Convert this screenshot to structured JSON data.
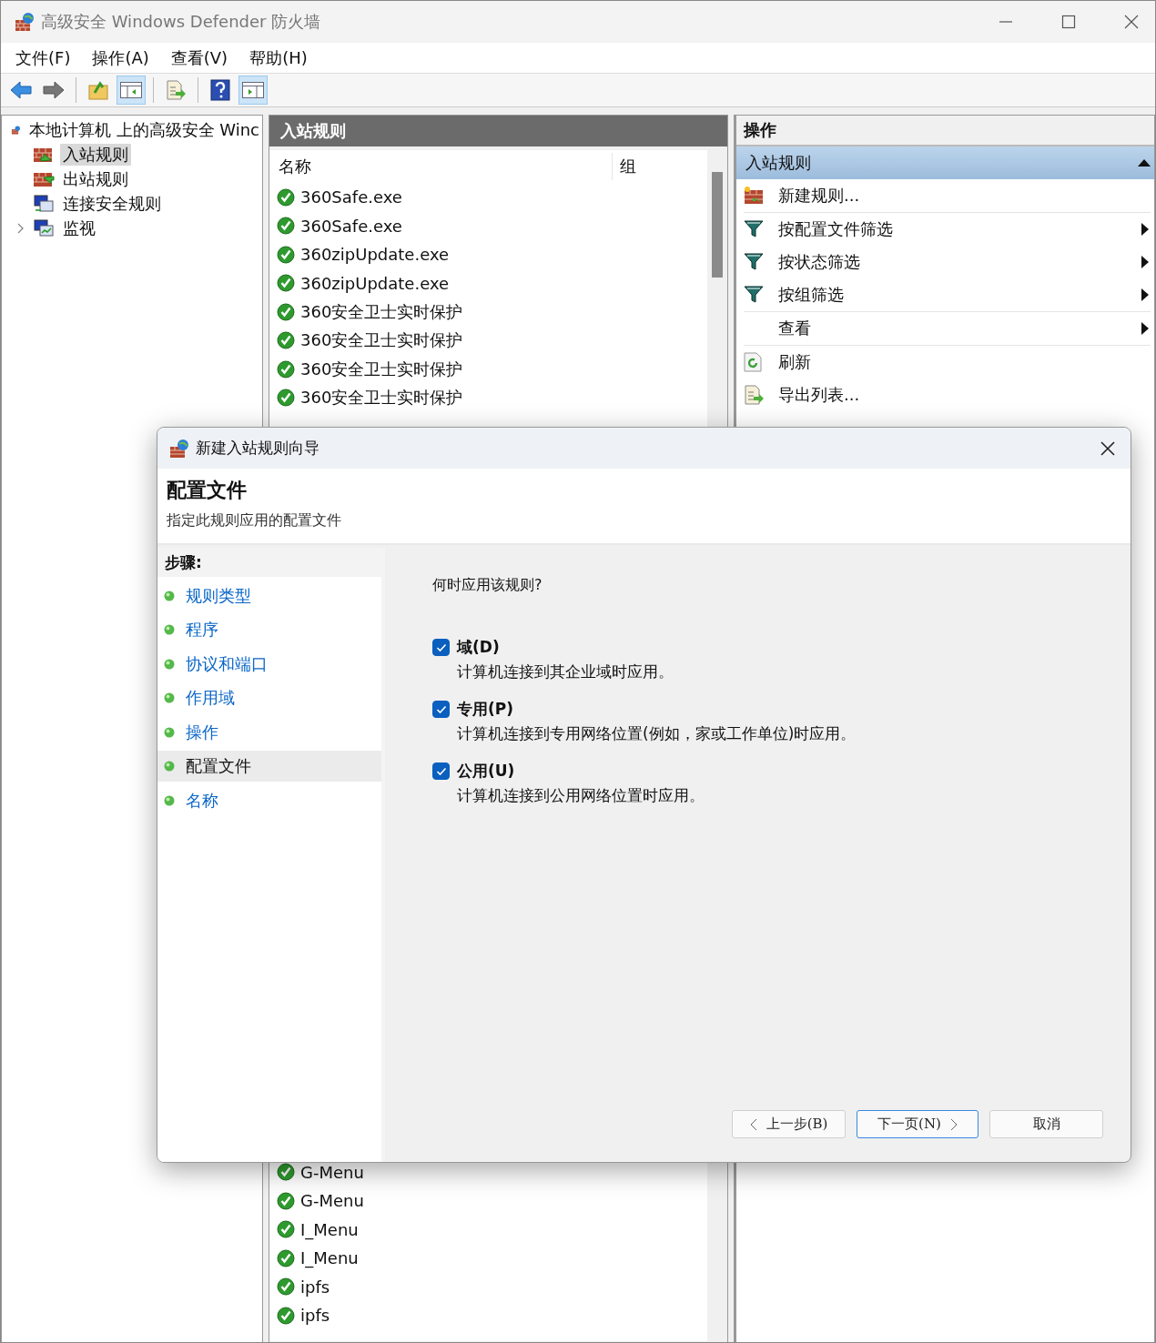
{
  "window": {
    "title": "高级安全 Windows Defender 防火墙"
  },
  "menu": [
    {
      "label": "文件(F)"
    },
    {
      "label": "操作(A)"
    },
    {
      "label": "查看(V)"
    },
    {
      "label": "帮助(H)"
    }
  ],
  "toolbar": [
    {
      "kind": "back",
      "pressed": false
    },
    {
      "kind": "forward",
      "pressed": false
    },
    {
      "kind": "up",
      "pressed": false
    },
    {
      "kind": "tree",
      "pressed": true
    },
    {
      "kind": "export",
      "pressed": false
    },
    {
      "kind": "help",
      "pressed": false
    },
    {
      "kind": "action-pane",
      "pressed": true
    }
  ],
  "tree": {
    "label": "本地计算机 上的高级安全 Winc",
    "children": [
      {
        "label": "入站规则",
        "kind": "inbound",
        "selected": true,
        "expandable": false
      },
      {
        "label": "出站规则",
        "kind": "outbound",
        "selected": false,
        "expandable": false
      },
      {
        "label": "连接安全规则",
        "kind": "connection",
        "selected": false,
        "expandable": false
      },
      {
        "label": "监视",
        "kind": "monitor",
        "selected": false,
        "expandable": true
      }
    ]
  },
  "rules_pane": {
    "title": "入站规则",
    "columns": [
      "名称",
      "组"
    ],
    "rows_top": [
      {
        "name": "360Safe.exe",
        "enabled": true
      },
      {
        "name": "360Safe.exe",
        "enabled": true
      },
      {
        "name": "360zipUpdate.exe",
        "enabled": true
      },
      {
        "name": "360zipUpdate.exe",
        "enabled": true
      },
      {
        "name": "360安全卫士实时保护",
        "enabled": true
      },
      {
        "name": "360安全卫士实时保护",
        "enabled": true
      },
      {
        "name": "360安全卫士实时保护",
        "enabled": true
      },
      {
        "name": "360安全卫士实时保护",
        "enabled": true
      }
    ],
    "rows_bottom": [
      {
        "name": "G-Menu",
        "enabled": true
      },
      {
        "name": "G-Menu",
        "enabled": true
      },
      {
        "name": "I_Menu",
        "enabled": true
      },
      {
        "name": "I_Menu",
        "enabled": true
      },
      {
        "name": "ipfs",
        "enabled": true
      },
      {
        "name": "ipfs",
        "enabled": true
      }
    ]
  },
  "actions_pane": {
    "title": "操作",
    "section": {
      "label": "入站规则",
      "expanded": true
    },
    "items": [
      {
        "label": "新建规则...",
        "kind": "new-rule",
        "submenu": false
      },
      {
        "label": "按配置文件筛选",
        "kind": "filter",
        "submenu": true
      },
      {
        "label": "按状态筛选",
        "kind": "filter",
        "submenu": true
      },
      {
        "label": "按组筛选",
        "kind": "filter",
        "submenu": true
      },
      {
        "label": "查看",
        "kind": "none",
        "submenu": true
      },
      {
        "label": "刷新",
        "kind": "refresh",
        "submenu": false
      },
      {
        "label": "导出列表...",
        "kind": "export",
        "submenu": false
      }
    ]
  },
  "dialog": {
    "title": "新建入站规则向导",
    "heading": "配置文件",
    "subheading": "指定此规则应用的配置文件",
    "steps_title": "步骤:",
    "steps": [
      {
        "label": "规则类型",
        "selected": false
      },
      {
        "label": "程序",
        "selected": false
      },
      {
        "label": "协议和端口",
        "selected": false
      },
      {
        "label": "作用域",
        "selected": false
      },
      {
        "label": "操作",
        "selected": false
      },
      {
        "label": "配置文件",
        "selected": true
      },
      {
        "label": "名称",
        "selected": false
      }
    ],
    "question": "何时应用该规则?",
    "options": [
      {
        "label": "域(D)",
        "description": "计算机连接到其企业域时应用。",
        "checked": true
      },
      {
        "label": "专用(P)",
        "description": "计算机连接到专用网络位置(例如，家或工作单位)时应用。",
        "checked": true
      },
      {
        "label": "公用(U)",
        "description": "计算机连接到公用网络位置时应用。",
        "checked": true
      }
    ],
    "buttons": [
      {
        "label": "上一步(B)",
        "kind": "back",
        "default": false
      },
      {
        "label": "下一页(N)",
        "kind": "next",
        "default": true
      },
      {
        "label": "取消",
        "kind": "cancel",
        "default": false
      }
    ]
  }
}
